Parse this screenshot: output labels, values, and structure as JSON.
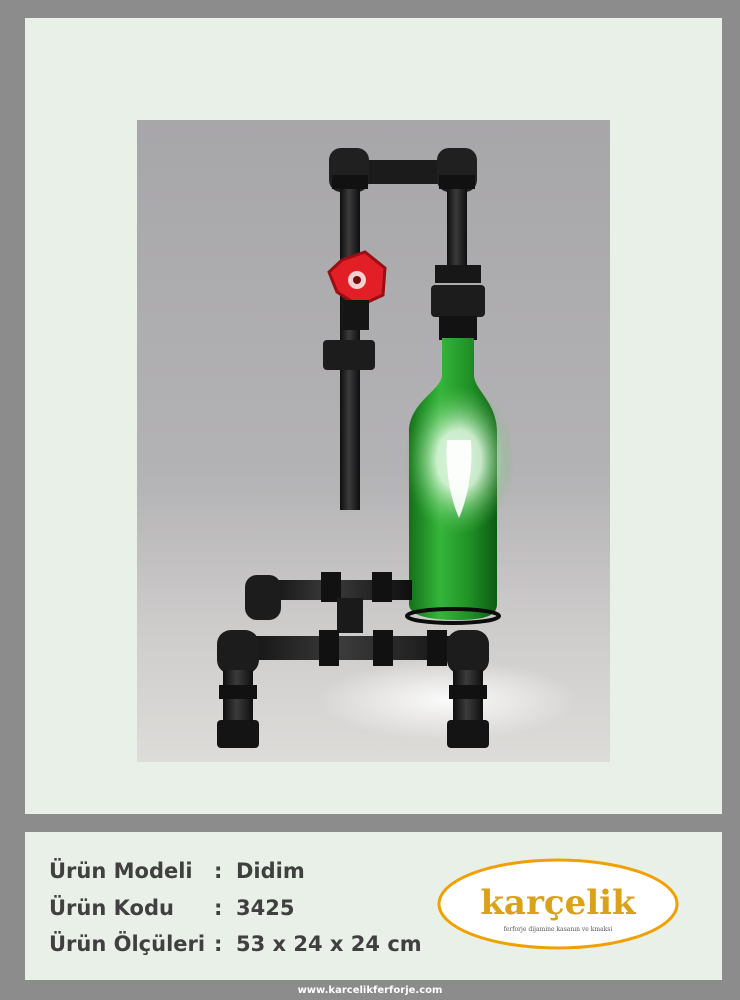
{
  "product": {
    "model_label": "Ürün Modeli",
    "model_sep": ":",
    "model_value": "Didim",
    "code_label": "Ürün Kodu",
    "code_sep": ":",
    "code_value": "3425",
    "size_label": "Ürün Ölçüleri",
    "size_sep": ":",
    "size_value": "53 x 24 x 24 cm"
  },
  "logo": {
    "name": "karçelik",
    "tagline": "ferforje dijamine kasanın ve kmaksi",
    "ring_color": "#f0a000",
    "text_color": "#d9a21a"
  },
  "footer": {
    "url": "www.karcelikferforje.com"
  },
  "colors": {
    "background": "#8c8c8c",
    "panel": "#e9f0e7",
    "text": "#404040",
    "valve": "#e21f26",
    "bottle": "#1e8a22"
  }
}
